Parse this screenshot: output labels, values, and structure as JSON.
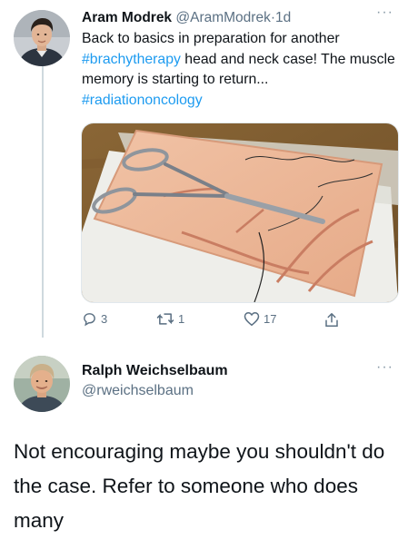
{
  "tweet1": {
    "author_name": "Aram Modrek",
    "author_handle": "@AramModrek",
    "separator": "·",
    "time": "1d",
    "more_label": "···",
    "text_part1": "Back to basics in preparation for another ",
    "hashtag1": "#brachytherapy",
    "text_part2": " head and neck case! The muscle memory is starting to return...",
    "hashtag2": "#radiationoncology",
    "image_icon": "suture-practice-pad-photo",
    "actions": {
      "reply_count": "3",
      "retweet_count": "1",
      "like_count": "17",
      "reply_icon": "reply-icon",
      "retweet_icon": "retweet-icon",
      "like_icon": "heart-icon",
      "share_icon": "share-icon"
    }
  },
  "tweet2": {
    "author_name": "Ralph Weichselbaum",
    "author_handle": "@rweichselbaum",
    "more_label": "···",
    "text": "Not encouraging maybe you shouldn't do the case. Refer to someone who does many"
  },
  "colors": {
    "link": "#1d9bf0",
    "muted": "#5b7083",
    "thread_line": "#cfd9de",
    "text": "#0f1419"
  }
}
